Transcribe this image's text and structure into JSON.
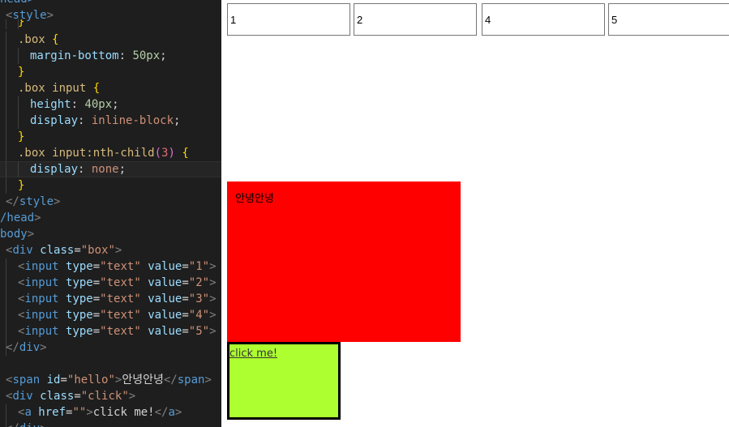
{
  "editor": {
    "lines": [
      [
        [
          "tag",
          "head>"
        ]
      ],
      [
        [
          "br",
          "<"
        ],
        [
          "tag",
          "style"
        ],
        [
          "br",
          ">"
        ]
      ],
      [
        [
          "par",
          "}"
        ]
      ],
      [
        [
          "sel",
          ".box "
        ],
        [
          "par",
          "{"
        ]
      ],
      [
        [
          "prop",
          "margin-bottom"
        ],
        [
          "txt",
          ": "
        ],
        [
          "num",
          "50px"
        ],
        [
          "txt",
          ";"
        ]
      ],
      [
        [
          "par",
          "}"
        ]
      ],
      [
        [
          "sel",
          ".box input "
        ],
        [
          "par",
          "{"
        ]
      ],
      [
        [
          "prop",
          "height"
        ],
        [
          "txt",
          ": "
        ],
        [
          "num",
          "40px"
        ],
        [
          "txt",
          ";"
        ]
      ],
      [
        [
          "prop",
          "display"
        ],
        [
          "txt",
          ": "
        ],
        [
          "val",
          "inline-block"
        ],
        [
          "txt",
          ";"
        ]
      ],
      [
        [
          "par",
          "}"
        ]
      ],
      [
        [
          "sel",
          ".box input:nth-child"
        ],
        [
          "pb",
          "("
        ],
        [
          "arg",
          "3"
        ],
        [
          "pb",
          ")"
        ],
        [
          "txt",
          " "
        ],
        [
          "par",
          "{"
        ]
      ],
      [
        [
          "prop",
          "display"
        ],
        [
          "txt",
          ": "
        ],
        [
          "val",
          "none"
        ],
        [
          "txt",
          ";"
        ]
      ],
      [
        [
          "par",
          "}"
        ]
      ],
      [
        [
          "br",
          "</"
        ],
        [
          "tag",
          "style"
        ],
        [
          "br",
          ">"
        ]
      ],
      [
        [
          "tag",
          "/head"
        ],
        [
          "br",
          ">"
        ]
      ],
      [
        [
          "tag",
          "body"
        ],
        [
          "br",
          ">"
        ]
      ],
      [
        [
          "br",
          "<"
        ],
        [
          "tag",
          "div "
        ],
        [
          "attr",
          "class"
        ],
        [
          "txt",
          "="
        ],
        [
          "str",
          "\"box\""
        ],
        [
          "br",
          ">"
        ]
      ],
      [
        [
          "br",
          "<"
        ],
        [
          "tag",
          "input "
        ],
        [
          "attr",
          "type"
        ],
        [
          "txt",
          "="
        ],
        [
          "str",
          "\"text\""
        ],
        [
          "txt",
          " "
        ],
        [
          "attr",
          "value"
        ],
        [
          "txt",
          "="
        ],
        [
          "str",
          "\"1\""
        ],
        [
          "br",
          ">"
        ]
      ],
      [
        [
          "br",
          "<"
        ],
        [
          "tag",
          "input "
        ],
        [
          "attr",
          "type"
        ],
        [
          "txt",
          "="
        ],
        [
          "str",
          "\"text\""
        ],
        [
          "txt",
          " "
        ],
        [
          "attr",
          "value"
        ],
        [
          "txt",
          "="
        ],
        [
          "str",
          "\"2\""
        ],
        [
          "br",
          ">"
        ]
      ],
      [
        [
          "br",
          "<"
        ],
        [
          "tag",
          "input "
        ],
        [
          "attr",
          "type"
        ],
        [
          "txt",
          "="
        ],
        [
          "str",
          "\"text\""
        ],
        [
          "txt",
          " "
        ],
        [
          "attr",
          "value"
        ],
        [
          "txt",
          "="
        ],
        [
          "str",
          "\"3\""
        ],
        [
          "br",
          ">"
        ]
      ],
      [
        [
          "br",
          "<"
        ],
        [
          "tag",
          "input "
        ],
        [
          "attr",
          "type"
        ],
        [
          "txt",
          "="
        ],
        [
          "str",
          "\"text\""
        ],
        [
          "txt",
          " "
        ],
        [
          "attr",
          "value"
        ],
        [
          "txt",
          "="
        ],
        [
          "str",
          "\"4\""
        ],
        [
          "br",
          ">"
        ]
      ],
      [
        [
          "br",
          "<"
        ],
        [
          "tag",
          "input "
        ],
        [
          "attr",
          "type"
        ],
        [
          "txt",
          "="
        ],
        [
          "str",
          "\"text\""
        ],
        [
          "txt",
          " "
        ],
        [
          "attr",
          "value"
        ],
        [
          "txt",
          "="
        ],
        [
          "str",
          "\"5\""
        ],
        [
          "br",
          ">"
        ]
      ],
      [
        [
          "br",
          "</"
        ],
        [
          "tag",
          "div"
        ],
        [
          "br",
          ">"
        ]
      ],
      [],
      [
        [
          "br",
          "<"
        ],
        [
          "tag",
          "span "
        ],
        [
          "attr",
          "id"
        ],
        [
          "txt",
          "="
        ],
        [
          "str",
          "\"hello\""
        ],
        [
          "br",
          ">"
        ],
        [
          "txt",
          "안녕안녕"
        ],
        [
          "br",
          "</"
        ],
        [
          "tag",
          "span"
        ],
        [
          "br",
          ">"
        ]
      ],
      [
        [
          "br",
          "<"
        ],
        [
          "tag",
          "div "
        ],
        [
          "attr",
          "class"
        ],
        [
          "txt",
          "="
        ],
        [
          "str",
          "\"click\""
        ],
        [
          "br",
          ">"
        ]
      ],
      [
        [
          "br",
          "<"
        ],
        [
          "tag",
          "a "
        ],
        [
          "attr",
          "href"
        ],
        [
          "txt",
          "="
        ],
        [
          "str",
          "\"\""
        ],
        [
          "br",
          ">"
        ],
        [
          "txt",
          "click me!"
        ],
        [
          "br",
          "</"
        ],
        [
          "tag",
          "a"
        ],
        [
          "br",
          ">"
        ]
      ],
      [
        [
          "br",
          "</"
        ],
        [
          "tag",
          "div"
        ],
        [
          "br",
          ">"
        ]
      ]
    ]
  },
  "preview": {
    "inputs": [
      "1",
      "2",
      "4",
      "5"
    ],
    "hello_text": "안녕안녕",
    "link_text": "click me!",
    "colors": {
      "hello_bg": "#ff0000",
      "click_bg": "#adff2f"
    }
  }
}
